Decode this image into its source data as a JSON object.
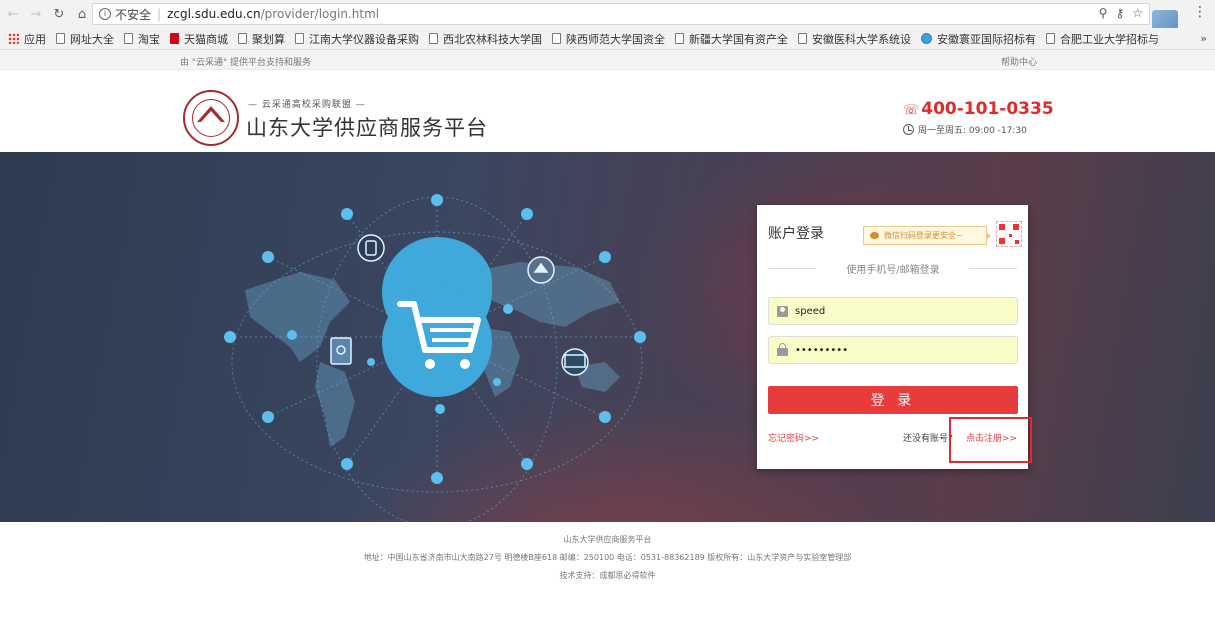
{
  "browser": {
    "security_label": "不安全",
    "url_host": "zcgl.sdu.edu.cn",
    "url_path": "/provider/login.html",
    "bookmarks": [
      "应用",
      "网址大全",
      "淘宝",
      "天猫商城",
      "聚划算",
      "江南大学仪器设备采购",
      "西北农林科技大学国",
      "陕西师范大学国资全",
      "新疆大学国有资产全",
      "安徽医科大学系统设",
      "安徽寰亚国际招标有",
      "合肥工业大学招标与"
    ],
    "more": "»"
  },
  "top_strip": {
    "left_text": "由 \"云采通\" 提供平台支持和服务",
    "help": "帮助中心"
  },
  "header": {
    "subtitle": "— 云采通高校采购联盟 —",
    "title": "山东大学供应商服务平台",
    "hotline": "400-101-0335",
    "hours": "周一至周五: 09:00 -17:30"
  },
  "login": {
    "title": "账户登录",
    "wechat_tip": "微信扫码登录更安全~",
    "divider": "使用手机号/邮箱登录",
    "username": "speed",
    "password": "•••••••••",
    "button": "登 录",
    "forgot": "忘记密码>>",
    "no_account": "还没有账号?",
    "register": "点击注册>>"
  },
  "footer": {
    "line1": "山东大学供应商服务平台",
    "line2": "地址：中国山东省济南市山大南路27号 明德楼B座618    邮编：250100    电话：0531-88362189    版权所有：山东大学资产与实验室管理部",
    "line3": "技术支持：成都思必得软件"
  },
  "colors": {
    "accent_red": "#e83b3b",
    "annotation_red": "#e8262b",
    "banner_blue": "#3fa9dc"
  }
}
